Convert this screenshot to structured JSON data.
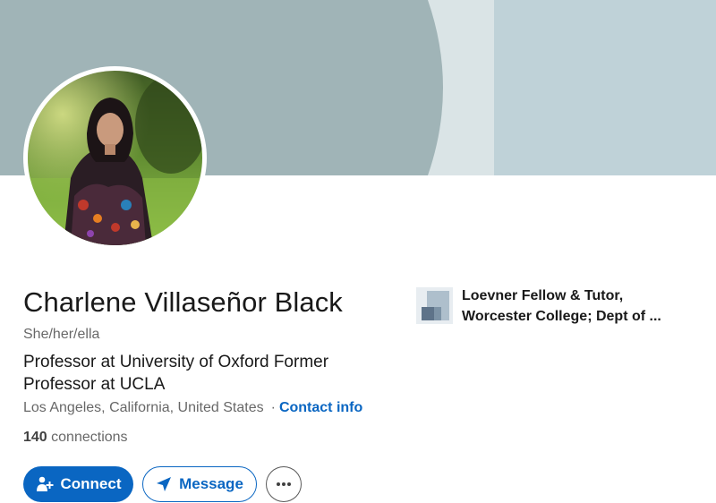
{
  "profile": {
    "name": "Charlene Villaseñor Black",
    "pronouns": "She/her/ella",
    "headline": "Professor at University of Oxford  Former Professor at UCLA",
    "location": "Los Angeles, California, United States",
    "location_separator": "·",
    "contact_info_label": "Contact info",
    "connections_count": "140",
    "connections_label": "connections"
  },
  "experience": {
    "line1": "Loevner Fellow & Tutor,",
    "line2": "Worcester College; Dept of ..."
  },
  "actions": {
    "connect_label": "Connect",
    "message_label": "Message",
    "more_icon": "ellipsis-icon",
    "connect_icon": "add-person-icon",
    "message_icon": "send-icon"
  },
  "colors": {
    "accent": "#0a66c2",
    "banner_dark": "#a0b4b7",
    "banner_light": "#dae4e6",
    "banner_right": "#bfd2d8"
  }
}
